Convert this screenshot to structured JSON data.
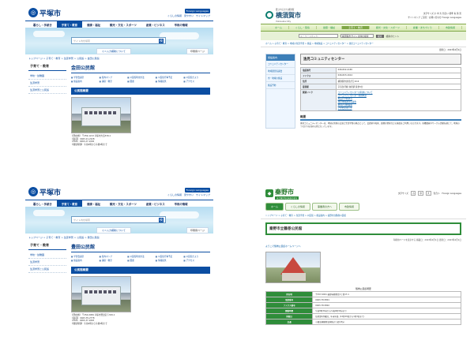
{
  "q1": {
    "city": "平塚市",
    "util_links": [
      "くらしの情報",
      "見やすい",
      "サイトマップ"
    ],
    "lang_label": "Foreign Languages",
    "nav": [
      "暮らし・手続き",
      "子育て・教育",
      "健康・福祉",
      "観光・文化・スポーツ",
      "産業・ビジネス",
      "市政の情報"
    ],
    "search_placeholder": "サイト内を検索",
    "search_btn": "検",
    "search_link": "ミニ入力補助について",
    "sub_btn": "印刷用ページ",
    "breadcrumb": "トップページ > 子育て・教育 > 生涯学習 > 公民館 > 金田公民館",
    "side_title": "子育て・教育",
    "side_items": [
      "学校・幼稚園",
      "生涯学習",
      "生涯学習と公民館"
    ],
    "title": "金田公民館",
    "tags": [
      "学習会議室",
      "館内マップ",
      "公民館利用方法",
      "公民館行事予定",
      "公民館だより",
      "施設案内",
      "講座・教室",
      "図書",
      "情報提供",
      "アクセス"
    ],
    "band": "公民館概要",
    "info": [
      "【所在地】 〒259-1213 平塚市大島339-1",
      "【電話】 0463-21-2228",
      "【FAX】 0463-27-1094",
      "【開館時間】 午前9時から午後9時まで"
    ]
  },
  "q2": {
    "city": "横須賀市",
    "tagline": "愛されるまち横須賀",
    "city_en": "Yokosuka City",
    "util_rows": [
      "文字サイズ 小 中 大  色合い 標準 青 黄 黒",
      "サイトマップ  ご意見・お問い合わせ  Foreign Languages"
    ],
    "nav": [
      "ホーム",
      "くらし・環境",
      "健康・福祉",
      "子育て・教育",
      "観光・文化・スポーツ",
      "産業・まちづくり",
      "市政情報"
    ],
    "search_placeholder": "キーワードを入力",
    "search_scope": "横須賀市サイト全体を検索",
    "search_btn": "検索",
    "search_help": "検索のヒント",
    "breadcrumb": "ホーム > 子育て・教育 > 地域の生涯学習 > 施設 > 地域施設 > コミュニティセンター > 逸見コミュニティセンター",
    "updated": "更新日：2023年4月1日",
    "side_title": "施設案内",
    "side_items": [
      "コミュニティセンター",
      "地域運営協議会",
      "市・地域の施設",
      "施設予約"
    ],
    "title": "逸見コミュニティセンター",
    "rows": [
      {
        "k": "電話番号",
        "v": "046-822-4165"
      },
      {
        "k": "ファクス",
        "v": "046-823-1614"
      },
      {
        "k": "住所",
        "v": "横須賀市逸見が丘10-6"
      },
      {
        "k": "最寄駅",
        "v": "京浜急行線 逸見駅 徒歩5分"
      }
    ],
    "links_label": "関連リンク",
    "links": [
      "コミュニティセンターの利用について",
      "コミュニティセンター利用申請",
      "施設の予約状況",
      "逸見地域運営協議会",
      "地域の活動情報",
      "アクセスマップ"
    ],
    "h2": "概要",
    "para": "逸見コミュニティセンターは、地域の皆様の交流と生涯学習の拠点として、会議室や和室、調理実習室などの施設をご利用いただけます。各種講座やサークル活動を通じて、地域のつながりを深める場となっています。"
  },
  "q3": {
    "city": "平塚市",
    "util_links": [
      "くらしの情報",
      "見やすい",
      "サイトマップ"
    ],
    "lang_label": "Foreign Languages",
    "nav": [
      "暮らし・手続き",
      "子育て・教育",
      "健康・福祉",
      "観光・文化・スポーツ",
      "産業・ビジネス",
      "市政の情報"
    ],
    "search_placeholder": "サイト内を検索",
    "search_btn": "検",
    "search_link": "ミニ入力補助について",
    "sub_btn": "印刷用ページ",
    "breadcrumb": "トップページ > 子育て・教育 > 生涯学習 > 公民館 > 豊田公民館",
    "side_title": "子育て・教育",
    "side_items": [
      "学校・幼稚園",
      "生涯学習",
      "生涯学習と公民館"
    ],
    "title": "豊田公民館",
    "tags": [
      "学習会議室",
      "館内マップ",
      "公民館利用方法",
      "公民館行事予定",
      "公民館だより",
      "施設案内",
      "講座・教室",
      "図書",
      "情報提供",
      "アクセス"
    ],
    "band": "公民館概要",
    "info": [
      "【所在地】 〒254-0084 平塚市豊田宮下329-1",
      "【電話】 0463-35-2778",
      "【FAX】 0463-37-1663",
      "【開館時間】 午前9時から午後9時まで"
    ]
  },
  "q4": {
    "city": "秦野市",
    "tagline": "水と緑が光る未来のまち",
    "util": [
      "文字サイズ",
      "小",
      "中",
      "大",
      "色合い",
      "Foreign Languages"
    ],
    "nav": [
      "ホーム",
      "くらしの情報",
      "事業者の方へ",
      "市政情報"
    ],
    "breadcrumb": "トップページ > 子育て・教育 > 生涯学習 > 公民館 > 施設案内 > 秦野市立鶴巻公民館",
    "title": "秦野市立鶴巻公民館",
    "meta": "印刷用ページを表示する  掲載日：2023年4月1日 更新日：2023年4月1日",
    "welcome": "ようこそ鶴巻公民館ホームページへ",
    "caption": "鶴巻公民館概要",
    "rows": [
      {
        "k": "所在地",
        "v": "〒257-0001 秦野市鶴巻北1丁目17-1"
      },
      {
        "k": "電話番号",
        "v": "0463-78-5801"
      },
      {
        "k": "ファクス番号",
        "v": "0463-78-5802"
      },
      {
        "k": "開館時間",
        "v": "午前8時30分から午後9時30分まで"
      },
      {
        "k": "休館日",
        "v": "毎月第2月曜日、年末年始（12月29日から1月3日まで）"
      },
      {
        "k": "交通",
        "v": "小田急線鶴巻温泉駅より徒歩5分"
      }
    ]
  }
}
